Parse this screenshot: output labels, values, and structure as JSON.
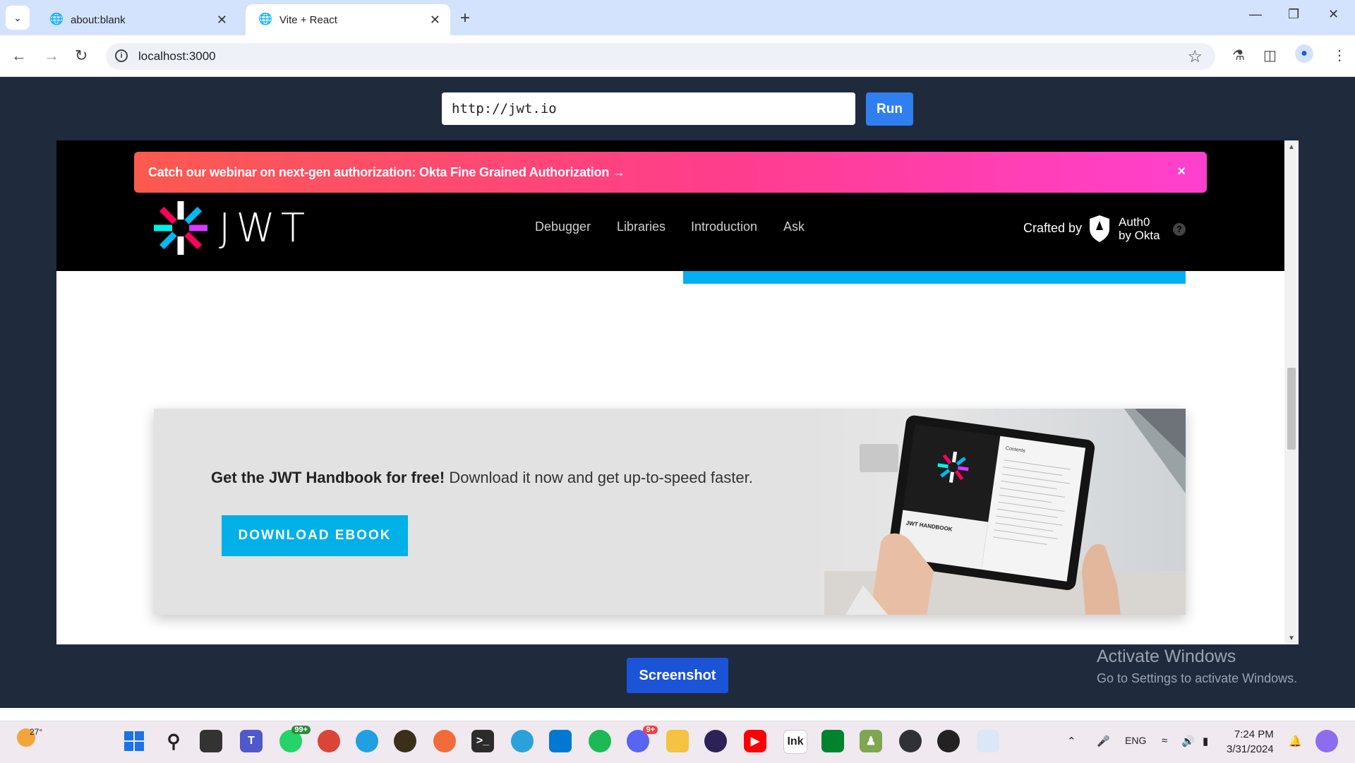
{
  "browser": {
    "tabs": [
      {
        "title": "about:blank",
        "active": false
      },
      {
        "title": "Vite + React",
        "active": true
      }
    ],
    "address": "localhost:3000"
  },
  "app": {
    "url_value": "http://jwt.io",
    "run_label": "Run",
    "screenshot_label": "Screenshot"
  },
  "site": {
    "banner_text": "Catch our webinar on next-gen authorization: Okta Fine Grained Authorization →",
    "banner_close": "×",
    "logo_text": "JWT",
    "nav": [
      "Debugger",
      "Libraries",
      "Introduction",
      "Ask"
    ],
    "crafted_by": "Crafted by",
    "auth0_line1": "Auth0",
    "auth0_line2": "by Okta",
    "help": "?",
    "ebook_bold": "Get the JWT Handbook for free!",
    "ebook_text": " Download it now and get up-to-speed faster.",
    "download_label": "DOWNLOAD EBOOK",
    "tablet_title": "JWT HANDBOOK",
    "tablet_toc": "Contents"
  },
  "watermark": {
    "line1": "Activate Windows",
    "line2": "Go to Settings to activate Windows."
  },
  "taskbar": {
    "weather": "27°",
    "whatsapp_badge": "99+",
    "discord_badge": "9+",
    "language": "ENG",
    "time": "7:24 PM",
    "date": "3/31/2024"
  },
  "colors": {
    "page_bg": "#1f2a3d",
    "run_button": "#2f7ff0",
    "screenshot_button": "#1c54d7",
    "download_button": "#00b0e6",
    "banner_start": "#fb5a4f",
    "banner_end": "#ff40cf"
  }
}
